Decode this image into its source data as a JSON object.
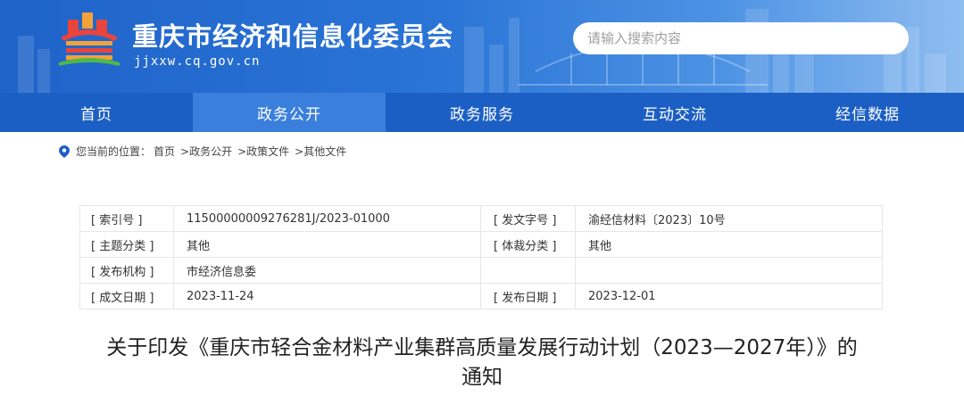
{
  "header": {
    "site_title": "重庆市经济和信息化委员会",
    "site_url": "jjxxw.cq.gov.cn",
    "search_placeholder": "请输入搜索内容"
  },
  "nav": {
    "items": [
      {
        "label": "首页"
      },
      {
        "label": "政务公开"
      },
      {
        "label": "政务服务"
      },
      {
        "label": "互动交流"
      },
      {
        "label": "经信数据"
      }
    ],
    "active_index": 1
  },
  "breadcrumb": {
    "prefix": "您当前的位置：",
    "items": [
      "首页",
      ">政务公开",
      ">政策文件",
      ">其他文件"
    ],
    "separator": " "
  },
  "info": {
    "rows": [
      {
        "k1": "[ 索引号 ]",
        "v1": "11500000009276281J/2023-01000",
        "k2": "[ 发文字号 ]",
        "v2": "渝经信材料〔2023〕10号"
      },
      {
        "k1": "[ 主题分类 ]",
        "v1": "其他",
        "k2": "[ 体裁分类 ]",
        "v2": "其他"
      },
      {
        "k1": "[ 发布机构 ]",
        "v1": "市经济信息委",
        "k2": "",
        "v2": ""
      },
      {
        "k1": "[ 成文日期 ]",
        "v1": "2023-11-24",
        "k2": "[ 发布日期 ]",
        "v2": "2023-12-01"
      }
    ]
  },
  "document": {
    "title_line1": "关于印发《重庆市轻合金材料产业集群高质量发展行动计划（2023—2027年）》的",
    "title_line2": "通知"
  },
  "colors": {
    "header_blue": "#1f63c9",
    "nav_blue": "#1c5fc4",
    "nav_active": "#3a7fdc"
  }
}
